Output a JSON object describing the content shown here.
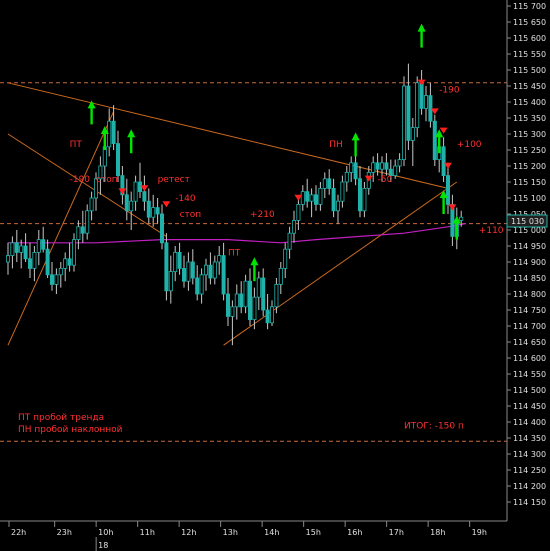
{
  "chart_data": {
    "type": "candlestick",
    "title": "",
    "ylim": [
      114150,
      115700
    ],
    "y_ticks": [
      115700,
      115650,
      115600,
      115550,
      115500,
      115450,
      115400,
      115350,
      115300,
      115250,
      115200,
      115150,
      115100,
      115050,
      115000,
      114950,
      114900,
      114850,
      114800,
      114750,
      114700,
      114650,
      114600,
      114550,
      114500,
      114450,
      114400,
      114350,
      114300,
      114250,
      114200,
      114150
    ],
    "x_ticks": [
      {
        "label": "22h",
        "x": 0
      },
      {
        "label": "23h",
        "x": 11
      },
      {
        "label": "10h",
        "x": 21
      },
      {
        "label": "11h",
        "x": 31
      },
      {
        "label": "12h",
        "x": 41
      },
      {
        "label": "13h",
        "x": 51
      },
      {
        "label": "14h",
        "x": 61
      },
      {
        "label": "15h",
        "x": 71
      },
      {
        "label": "16h",
        "x": 81
      },
      {
        "label": "17h",
        "x": 91
      },
      {
        "label": "18h",
        "x": 101
      },
      {
        "label": "19h",
        "x": 111
      }
    ],
    "date_marker": {
      "label": "18",
      "x": 21
    },
    "current_price": "115 030",
    "candles": [
      {
        "x": 0,
        "o": 114900,
        "h": 114960,
        "l": 114860,
        "c": 114920
      },
      {
        "x": 1,
        "o": 114920,
        "h": 114980,
        "l": 114880,
        "c": 114960
      },
      {
        "x": 2,
        "o": 114960,
        "h": 115000,
        "l": 114900,
        "c": 114930
      },
      {
        "x": 3,
        "o": 114930,
        "h": 114970,
        "l": 114880,
        "c": 114950
      },
      {
        "x": 4,
        "o": 114950,
        "h": 114990,
        "l": 114900,
        "c": 114910
      },
      {
        "x": 5,
        "o": 114910,
        "h": 114960,
        "l": 114850,
        "c": 114880
      },
      {
        "x": 6,
        "o": 114880,
        "h": 114950,
        "l": 114840,
        "c": 114930
      },
      {
        "x": 7,
        "o": 114930,
        "h": 115000,
        "l": 114890,
        "c": 114970
      },
      {
        "x": 8,
        "o": 114970,
        "h": 115010,
        "l": 114930,
        "c": 114940
      },
      {
        "x": 9,
        "o": 114940,
        "h": 114970,
        "l": 114850,
        "c": 114860
      },
      {
        "x": 10,
        "o": 114860,
        "h": 114900,
        "l": 114810,
        "c": 114830
      },
      {
        "x": 11,
        "o": 114830,
        "h": 114880,
        "l": 114800,
        "c": 114860
      },
      {
        "x": 12,
        "o": 114860,
        "h": 114900,
        "l": 114820,
        "c": 114880
      },
      {
        "x": 13,
        "o": 114880,
        "h": 114930,
        "l": 114840,
        "c": 114910
      },
      {
        "x": 14,
        "o": 114910,
        "h": 114960,
        "l": 114870,
        "c": 114890
      },
      {
        "x": 15,
        "o": 114890,
        "h": 114990,
        "l": 114870,
        "c": 114970
      },
      {
        "x": 16,
        "o": 114970,
        "h": 115030,
        "l": 114940,
        "c": 115010
      },
      {
        "x": 17,
        "o": 115010,
        "h": 115060,
        "l": 114960,
        "c": 114990
      },
      {
        "x": 18,
        "o": 114990,
        "h": 115080,
        "l": 114970,
        "c": 115060
      },
      {
        "x": 19,
        "o": 115060,
        "h": 115120,
        "l": 115030,
        "c": 115100
      },
      {
        "x": 20,
        "o": 115100,
        "h": 115180,
        "l": 115060,
        "c": 115160
      },
      {
        "x": 21,
        "o": 115160,
        "h": 115230,
        "l": 115110,
        "c": 115200
      },
      {
        "x": 22,
        "o": 115200,
        "h": 115280,
        "l": 115150,
        "c": 115260
      },
      {
        "x": 23,
        "o": 115260,
        "h": 115380,
        "l": 115230,
        "c": 115340
      },
      {
        "x": 24,
        "o": 115340,
        "h": 115390,
        "l": 115250,
        "c": 115270
      },
      {
        "x": 25,
        "o": 115270,
        "h": 115310,
        "l": 115150,
        "c": 115170
      },
      {
        "x": 26,
        "o": 115170,
        "h": 115200,
        "l": 115080,
        "c": 115110
      },
      {
        "x": 27,
        "o": 115110,
        "h": 115160,
        "l": 115030,
        "c": 115060
      },
      {
        "x": 28,
        "o": 115060,
        "h": 115120,
        "l": 115000,
        "c": 115090
      },
      {
        "x": 29,
        "o": 115090,
        "h": 115170,
        "l": 115060,
        "c": 115150
      },
      {
        "x": 30,
        "o": 115150,
        "h": 115210,
        "l": 115100,
        "c": 115120
      },
      {
        "x": 31,
        "o": 115120,
        "h": 115170,
        "l": 115060,
        "c": 115090
      },
      {
        "x": 32,
        "o": 115090,
        "h": 115130,
        "l": 115020,
        "c": 115040
      },
      {
        "x": 33,
        "o": 115040,
        "h": 115110,
        "l": 115010,
        "c": 115070
      },
      {
        "x": 34,
        "o": 115070,
        "h": 115100,
        "l": 115020,
        "c": 115050
      },
      {
        "x": 35,
        "o": 115050,
        "h": 115080,
        "l": 114940,
        "c": 114960
      },
      {
        "x": 36,
        "o": 114960,
        "h": 114990,
        "l": 114780,
        "c": 114810
      },
      {
        "x": 37,
        "o": 114810,
        "h": 114920,
        "l": 114770,
        "c": 114870
      },
      {
        "x": 38,
        "o": 114870,
        "h": 114950,
        "l": 114840,
        "c": 114930
      },
      {
        "x": 39,
        "o": 114930,
        "h": 114960,
        "l": 114860,
        "c": 114880
      },
      {
        "x": 40,
        "o": 114880,
        "h": 114920,
        "l": 114820,
        "c": 114840
      },
      {
        "x": 41,
        "o": 114840,
        "h": 114930,
        "l": 114810,
        "c": 114900
      },
      {
        "x": 42,
        "o": 114900,
        "h": 114940,
        "l": 114830,
        "c": 114850
      },
      {
        "x": 43,
        "o": 114850,
        "h": 114890,
        "l": 114780,
        "c": 114800
      },
      {
        "x": 44,
        "o": 114800,
        "h": 114880,
        "l": 114770,
        "c": 114860
      },
      {
        "x": 45,
        "o": 114860,
        "h": 114910,
        "l": 114810,
        "c": 114890
      },
      {
        "x": 46,
        "o": 114890,
        "h": 114930,
        "l": 114830,
        "c": 114850
      },
      {
        "x": 47,
        "o": 114850,
        "h": 114920,
        "l": 114830,
        "c": 114900
      },
      {
        "x": 48,
        "o": 114900,
        "h": 114950,
        "l": 114860,
        "c": 114920
      },
      {
        "x": 49,
        "o": 114920,
        "h": 114960,
        "l": 114780,
        "c": 114800
      },
      {
        "x": 50,
        "o": 114800,
        "h": 114850,
        "l": 114700,
        "c": 114730
      },
      {
        "x": 51,
        "o": 114730,
        "h": 114780,
        "l": 114640,
        "c": 114760
      },
      {
        "x": 52,
        "o": 114760,
        "h": 114830,
        "l": 114720,
        "c": 114800
      },
      {
        "x": 53,
        "o": 114800,
        "h": 114840,
        "l": 114740,
        "c": 114760
      },
      {
        "x": 54,
        "o": 114760,
        "h": 114860,
        "l": 114740,
        "c": 114840
      },
      {
        "x": 55,
        "o": 114840,
        "h": 114880,
        "l": 114700,
        "c": 114720
      },
      {
        "x": 56,
        "o": 114720,
        "h": 114820,
        "l": 114690,
        "c": 114790
      },
      {
        "x": 57,
        "o": 114790,
        "h": 114870,
        "l": 114750,
        "c": 114850
      },
      {
        "x": 58,
        "o": 114850,
        "h": 114880,
        "l": 114730,
        "c": 114750
      },
      {
        "x": 59,
        "o": 114750,
        "h": 114800,
        "l": 114690,
        "c": 114710
      },
      {
        "x": 60,
        "o": 114710,
        "h": 114780,
        "l": 114700,
        "c": 114760
      },
      {
        "x": 61,
        "o": 114760,
        "h": 114850,
        "l": 114740,
        "c": 114830
      },
      {
        "x": 62,
        "o": 114830,
        "h": 114900,
        "l": 114800,
        "c": 114880
      },
      {
        "x": 63,
        "o": 114880,
        "h": 114960,
        "l": 114850,
        "c": 114940
      },
      {
        "x": 64,
        "o": 114940,
        "h": 115010,
        "l": 114910,
        "c": 114990
      },
      {
        "x": 65,
        "o": 114990,
        "h": 115060,
        "l": 114960,
        "c": 115030
      },
      {
        "x": 66,
        "o": 115030,
        "h": 115100,
        "l": 115000,
        "c": 115080
      },
      {
        "x": 67,
        "o": 115080,
        "h": 115140,
        "l": 115060,
        "c": 115120
      },
      {
        "x": 68,
        "o": 115120,
        "h": 115160,
        "l": 115070,
        "c": 115090
      },
      {
        "x": 69,
        "o": 115090,
        "h": 115130,
        "l": 115040,
        "c": 115110
      },
      {
        "x": 70,
        "o": 115110,
        "h": 115140,
        "l": 115060,
        "c": 115080
      },
      {
        "x": 71,
        "o": 115080,
        "h": 115150,
        "l": 115060,
        "c": 115130
      },
      {
        "x": 72,
        "o": 115130,
        "h": 115180,
        "l": 115100,
        "c": 115160
      },
      {
        "x": 73,
        "o": 115160,
        "h": 115190,
        "l": 115110,
        "c": 115130
      },
      {
        "x": 74,
        "o": 115130,
        "h": 115160,
        "l": 115040,
        "c": 115060
      },
      {
        "x": 75,
        "o": 115060,
        "h": 115110,
        "l": 115020,
        "c": 115090
      },
      {
        "x": 76,
        "o": 115090,
        "h": 115170,
        "l": 115070,
        "c": 115150
      },
      {
        "x": 77,
        "o": 115150,
        "h": 115200,
        "l": 115120,
        "c": 115180
      },
      {
        "x": 78,
        "o": 115180,
        "h": 115230,
        "l": 115150,
        "c": 115210
      },
      {
        "x": 79,
        "o": 115210,
        "h": 115250,
        "l": 115140,
        "c": 115160
      },
      {
        "x": 80,
        "o": 115160,
        "h": 115200,
        "l": 115040,
        "c": 115060
      },
      {
        "x": 81,
        "o": 115060,
        "h": 115150,
        "l": 115040,
        "c": 115130
      },
      {
        "x": 82,
        "o": 115130,
        "h": 115200,
        "l": 115110,
        "c": 115180
      },
      {
        "x": 83,
        "o": 115180,
        "h": 115230,
        "l": 115150,
        "c": 115210
      },
      {
        "x": 84,
        "o": 115210,
        "h": 115240,
        "l": 115170,
        "c": 115190
      },
      {
        "x": 85,
        "o": 115190,
        "h": 115230,
        "l": 115150,
        "c": 115210
      },
      {
        "x": 86,
        "o": 115210,
        "h": 115240,
        "l": 115170,
        "c": 115190
      },
      {
        "x": 87,
        "o": 115190,
        "h": 115220,
        "l": 115150,
        "c": 115170
      },
      {
        "x": 88,
        "o": 115170,
        "h": 115220,
        "l": 115160,
        "c": 115200
      },
      {
        "x": 89,
        "o": 115200,
        "h": 115240,
        "l": 115180,
        "c": 115220
      },
      {
        "x": 90,
        "o": 115220,
        "h": 115480,
        "l": 115200,
        "c": 115450
      },
      {
        "x": 91,
        "o": 115450,
        "h": 115520,
        "l": 115250,
        "c": 115280
      },
      {
        "x": 92,
        "o": 115280,
        "h": 115350,
        "l": 115200,
        "c": 115320
      },
      {
        "x": 93,
        "o": 115320,
        "h": 115480,
        "l": 115290,
        "c": 115460
      },
      {
        "x": 94,
        "o": 115460,
        "h": 115500,
        "l": 115360,
        "c": 115380
      },
      {
        "x": 95,
        "o": 115380,
        "h": 115450,
        "l": 115340,
        "c": 115420
      },
      {
        "x": 96,
        "o": 115420,
        "h": 115460,
        "l": 115320,
        "c": 115340
      },
      {
        "x": 97,
        "o": 115340,
        "h": 115360,
        "l": 115200,
        "c": 115220
      },
      {
        "x": 98,
        "o": 115220,
        "h": 115280,
        "l": 115180,
        "c": 115260
      },
      {
        "x": 99,
        "o": 115260,
        "h": 115290,
        "l": 115150,
        "c": 115170
      },
      {
        "x": 100,
        "o": 115170,
        "h": 115210,
        "l": 115050,
        "c": 115080
      },
      {
        "x": 101,
        "o": 115080,
        "h": 115110,
        "l": 114950,
        "c": 114980
      },
      {
        "x": 102,
        "o": 114980,
        "h": 115070,
        "l": 114940,
        "c": 115030
      },
      {
        "x": 103,
        "o": 115030,
        "h": 115060,
        "l": 115010,
        "c": 115040
      }
    ],
    "ma_series": [
      {
        "x": 0,
        "y": 114960
      },
      {
        "x": 20,
        "y": 114960
      },
      {
        "x": 35,
        "y": 114970
      },
      {
        "x": 50,
        "y": 114970
      },
      {
        "x": 62,
        "y": 114960
      },
      {
        "x": 70,
        "y": 114970
      },
      {
        "x": 80,
        "y": 114980
      },
      {
        "x": 90,
        "y": 114990
      },
      {
        "x": 100,
        "y": 115010
      },
      {
        "x": 104,
        "y": 115020
      }
    ],
    "h_levels": [
      115460,
      115020,
      114340
    ],
    "trend_lines": [
      {
        "name": "resistance-upper",
        "from": {
          "x": 0,
          "y": 115460
        },
        "to": {
          "x": 100,
          "y": 115130
        }
      },
      {
        "name": "resistance-lower",
        "from": {
          "x": 0,
          "y": 115300
        },
        "to": {
          "x": 36,
          "y": 114980
        }
      },
      {
        "name": "support-left",
        "from": {
          "x": 0,
          "y": 114640
        },
        "to": {
          "x": 24,
          "y": 115370
        }
      },
      {
        "name": "support-right",
        "from": {
          "x": 49,
          "y": 114640
        },
        "to": {
          "x": 102,
          "y": 115150
        }
      }
    ],
    "arrows": [
      {
        "x": 19,
        "y": 115330,
        "dir": "up",
        "color": "#00e600"
      },
      {
        "x": 22,
        "y": 115250,
        "dir": "up",
        "color": "#00e600"
      },
      {
        "x": 28,
        "y": 115240,
        "dir": "up",
        "color": "#00e600"
      },
      {
        "x": 26,
        "y": 115130,
        "dir": "down",
        "color": "#ff2020"
      },
      {
        "x": 31,
        "y": 115140,
        "dir": "down",
        "color": "#ff2020"
      },
      {
        "x": 36,
        "y": 115090,
        "dir": "down",
        "color": "#ff2020"
      },
      {
        "x": 56,
        "y": 114840,
        "dir": "up",
        "color": "#00e600"
      },
      {
        "x": 66,
        "y": 115110,
        "dir": "down",
        "color": "#ff2020"
      },
      {
        "x": 79,
        "y": 115230,
        "dir": "up",
        "color": "#00e600"
      },
      {
        "x": 82,
        "y": 115170,
        "dir": "down",
        "color": "#ff2020"
      },
      {
        "x": 94,
        "y": 115570,
        "dir": "up",
        "color": "#00e600"
      },
      {
        "x": 94,
        "y": 115470,
        "dir": "down",
        "color": "#ff2020"
      },
      {
        "x": 97,
        "y": 115380,
        "dir": "down",
        "color": "#ff2020"
      },
      {
        "x": 99,
        "y": 115320,
        "dir": "down",
        "color": "#ff2020"
      },
      {
        "x": 98,
        "y": 115240,
        "dir": "up",
        "color": "#00e600"
      },
      {
        "x": 100,
        "y": 115210,
        "dir": "down",
        "color": "#ff2020"
      },
      {
        "x": 99,
        "y": 115050,
        "dir": "up",
        "color": "#00e600"
      },
      {
        "x": 101,
        "y": 115080,
        "dir": "down",
        "color": "#ff2020"
      },
      {
        "x": 102,
        "y": 114970,
        "dir": "up",
        "color": "#00e600"
      }
    ],
    "annotations": [
      {
        "text": "ПТ",
        "x": 14,
        "y": 115260,
        "color": "#ff3030"
      },
      {
        "text": "-190",
        "x": 14,
        "y": 115150,
        "color": "#ff3030"
      },
      {
        "text": "стоп",
        "x": 20,
        "y": 115150,
        "color": "#ff3030"
      },
      {
        "text": "ретест",
        "x": 34,
        "y": 115150,
        "color": "#ff3030"
      },
      {
        "text": "-140",
        "x": 38,
        "y": 115090,
        "color": "#ff3030"
      },
      {
        "text": "стоп",
        "x": 39,
        "y": 115040,
        "color": "#ff3030"
      },
      {
        "text": "+210",
        "x": 55,
        "y": 115040,
        "color": "#ff3030"
      },
      {
        "text": "ПТ",
        "x": 50,
        "y": 114920,
        "color": "#ff3030"
      },
      {
        "text": "ПН",
        "x": 73,
        "y": 115260,
        "color": "#ff3030"
      },
      {
        "text": "-50",
        "x": 84,
        "y": 115150,
        "color": "#ff3030"
      },
      {
        "text": "-190",
        "x": 98,
        "y": 115430,
        "color": "#ff3030"
      },
      {
        "text": "+100",
        "x": 102,
        "y": 115260,
        "color": "#ff3030"
      },
      {
        "text": "+110",
        "x": 107,
        "y": 114990,
        "color": "#ff3030"
      },
      {
        "text": "ИТОГ: -150 п",
        "x": 90,
        "y": 114380,
        "color": "#ff3030"
      }
    ],
    "legend": [
      "ПТ пробой тренда",
      "ПН пробой наклонной"
    ],
    "colors": {
      "background": "#000000",
      "candle_up": "#20b2aa",
      "candle_down": "#20b2aa",
      "ma": "#c020c0",
      "trend": "#cc6a1e",
      "level": "#c86a3a",
      "text": "#e0e0e0",
      "annotation": "#ff3030"
    }
  }
}
